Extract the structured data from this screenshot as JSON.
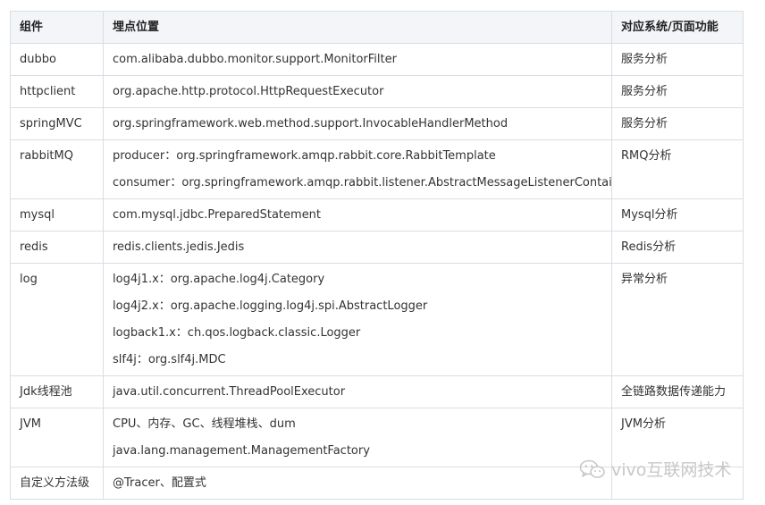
{
  "table": {
    "headers": [
      "组件",
      "埋点位置",
      "对应系统/页面功能"
    ],
    "rows": [
      {
        "component": "dubbo",
        "positions": [
          "com.alibaba.dubbo.monitor.support.MonitorFilter"
        ],
        "feature": "服务分析"
      },
      {
        "component": "httpclient",
        "positions": [
          "org.apache.http.protocol.HttpRequestExecutor"
        ],
        "feature": "服务分析"
      },
      {
        "component": "springMVC",
        "positions": [
          "org.springframework.web.method.support.InvocableHandlerMethod"
        ],
        "feature": "服务分析"
      },
      {
        "component": "rabbitMQ",
        "positions": [
          "producer：org.springframework.amqp.rabbit.core.RabbitTemplate",
          "consumer：org.springframework.amqp.rabbit.listener.AbstractMessageListenerContainer"
        ],
        "feature": "RMQ分析"
      },
      {
        "component": "mysql",
        "positions": [
          "com.mysql.jdbc.PreparedStatement"
        ],
        "feature": "Mysql分析"
      },
      {
        "component": "redis",
        "positions": [
          "redis.clients.jedis.Jedis"
        ],
        "feature": "Redis分析"
      },
      {
        "component": "log",
        "positions": [
          "log4j1.x：org.apache.log4j.Category",
          "log4j2.x：org.apache.logging.log4j.spi.AbstractLogger",
          "logback1.x：ch.qos.logback.classic.Logger",
          "slf4j：org.slf4j.MDC"
        ],
        "feature": "异常分析"
      },
      {
        "component": "Jdk线程池",
        "positions": [
          "java.util.concurrent.ThreadPoolExecutor"
        ],
        "feature": "全链路数据传递能力"
      },
      {
        "component": "JVM",
        "positions": [
          "CPU、内存、GC、线程堆栈、dum",
          "java.lang.management.ManagementFactory"
        ],
        "feature": "JVM分析"
      },
      {
        "component": "自定义方法级",
        "positions": [
          "@Tracer、配置式"
        ],
        "feature": ""
      }
    ]
  },
  "watermark": {
    "text": "vivo互联网技术",
    "icon": "wechat-icon"
  }
}
